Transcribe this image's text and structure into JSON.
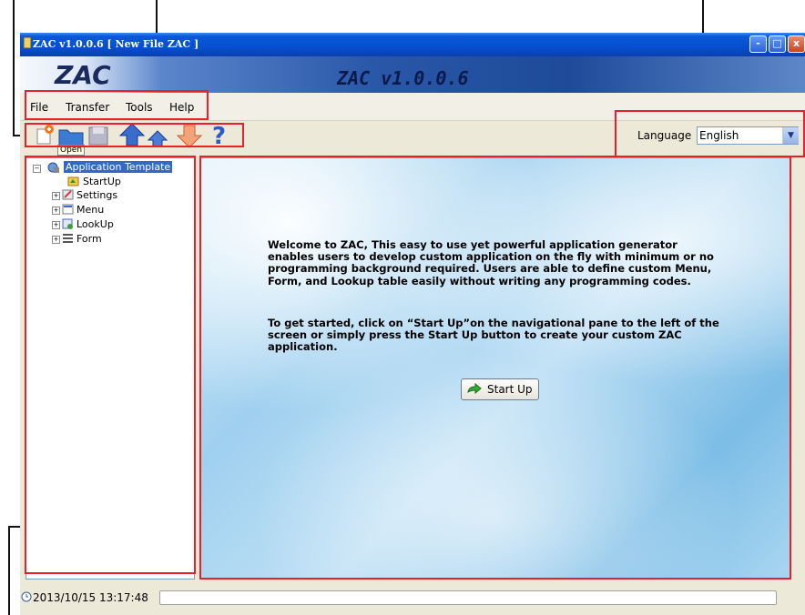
{
  "window": {
    "title": "ZAC v1.0.0.6 [ New File ZAC ]",
    "controls": {
      "minimize": "-",
      "maximize": "□",
      "close": "x"
    }
  },
  "banner": {
    "logo": "ZAC",
    "title": "ZAC v1.0.0.6"
  },
  "menu": {
    "items": [
      "File",
      "Transfer",
      "Tools",
      "Help"
    ]
  },
  "toolbar": {
    "tooltip": "Open",
    "tools": [
      "new-icon",
      "open-folder-icon",
      "save-icon",
      "upload-icon",
      "upload-small-icon",
      "download-icon",
      "help-icon"
    ],
    "language_label": "Language",
    "language_value": "English"
  },
  "tree": {
    "root": "Application Template",
    "items": [
      "StartUp",
      "Settings",
      "Menu",
      "LookUp",
      "Form"
    ]
  },
  "content": {
    "paragraph1": "Welcome to ZAC, This easy to use yet powerful application generator enables users to develop custom application on the fly with minimum or no programming background required. Users are able to define custom Menu, Form, and Lookup table easily without writing any programming codes.",
    "paragraph2": "To get started, click on “Start Up”on the navigational pane to the left of the screen or simply press the Start Up button to create your custom ZAC application.",
    "startup_button": "Start Up"
  },
  "status": {
    "datetime": "2013/10/15 13:17:48"
  },
  "colors": {
    "callout": "#e8202a",
    "titlebar": "#0a58d8",
    "selection": "#316ac5"
  }
}
